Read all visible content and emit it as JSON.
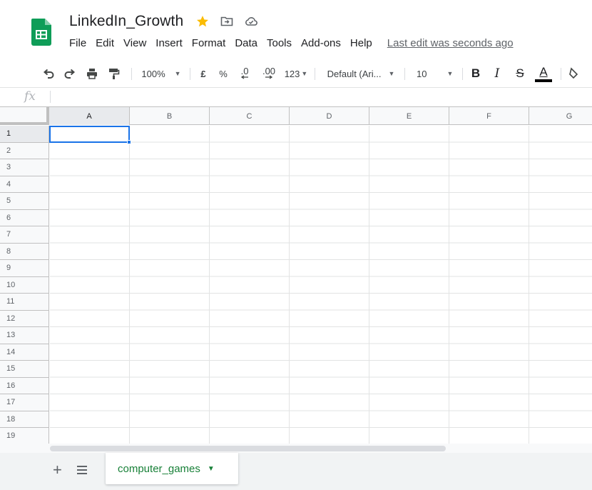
{
  "app": {
    "doc_title": "LinkedIn_Growth",
    "logo_icon": "sheets-logo-icon",
    "brand_color": "#0f9d58"
  },
  "title_icons": [
    "star-icon",
    "move-to-folder-icon",
    "cloud-status-icon"
  ],
  "menu": {
    "items": [
      "File",
      "Edit",
      "View",
      "Insert",
      "Format",
      "Data",
      "Tools",
      "Add-ons",
      "Help"
    ],
    "last_edit": "Last edit was seconds ago"
  },
  "toolbar": {
    "zoom": "100%",
    "currency": "£",
    "percent": "%",
    "decrease_decimal": ".0",
    "increase_decimal": ".00",
    "more_formats": "123",
    "font": "Default (Ari...",
    "font_size": "10",
    "bold": "B",
    "italic": "I",
    "strike": "S",
    "text_color": "A"
  },
  "formula_bar": {
    "label": "fx",
    "value": ""
  },
  "grid": {
    "columns": [
      "A",
      "B",
      "C",
      "D",
      "E",
      "F",
      "G"
    ],
    "rows": [
      "1",
      "2",
      "3",
      "4",
      "5",
      "6",
      "7",
      "8",
      "9",
      "10",
      "11",
      "12",
      "13",
      "14",
      "15",
      "16",
      "17",
      "18",
      "19"
    ],
    "active_cell": "A1",
    "selection_color": "#1a73e8"
  },
  "sheets": {
    "tabs": [
      {
        "label": "computer_games",
        "active": true
      }
    ],
    "active_color": "#188038"
  }
}
